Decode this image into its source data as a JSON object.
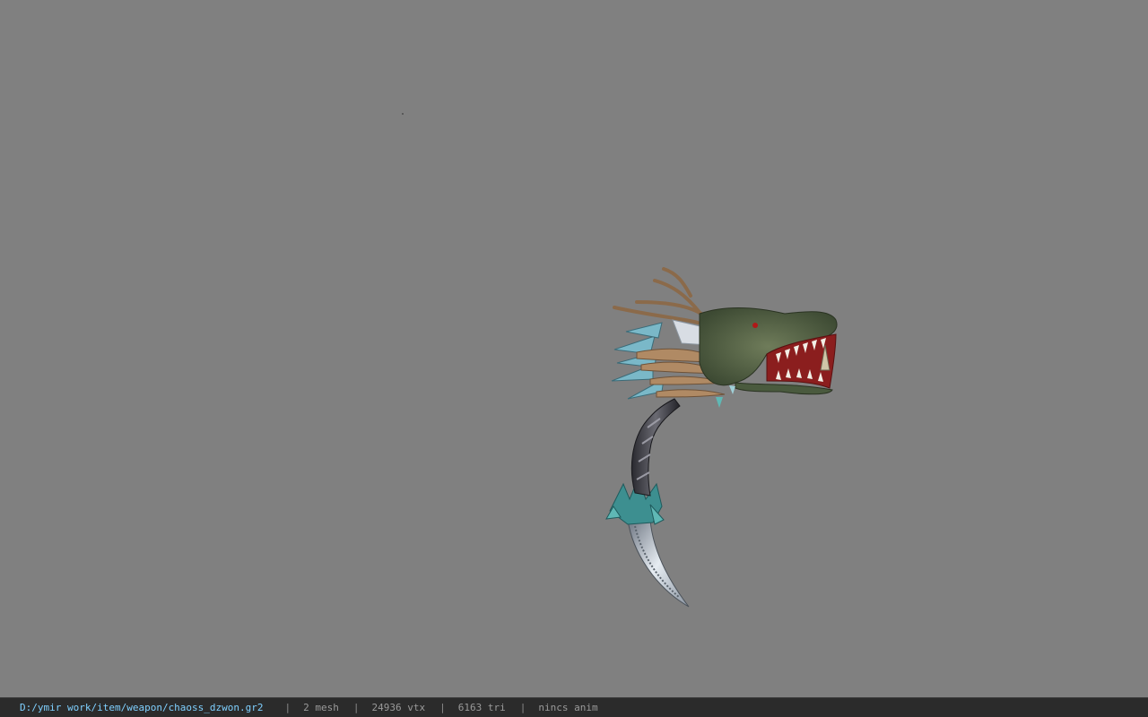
{
  "viewport": {
    "background_color": "#808080",
    "model_name": "dragon-head-blade-weapon"
  },
  "statusbar": {
    "file_path": "D:/ymir work/item/weapon/chaoss_dzwon.gr2",
    "separator": "|",
    "mesh_count": "2 mesh",
    "vertex_count": "24936 vtx",
    "triangle_count": "6163 tri",
    "animation": "nincs anim",
    "path_color": "#7fd0ff"
  }
}
